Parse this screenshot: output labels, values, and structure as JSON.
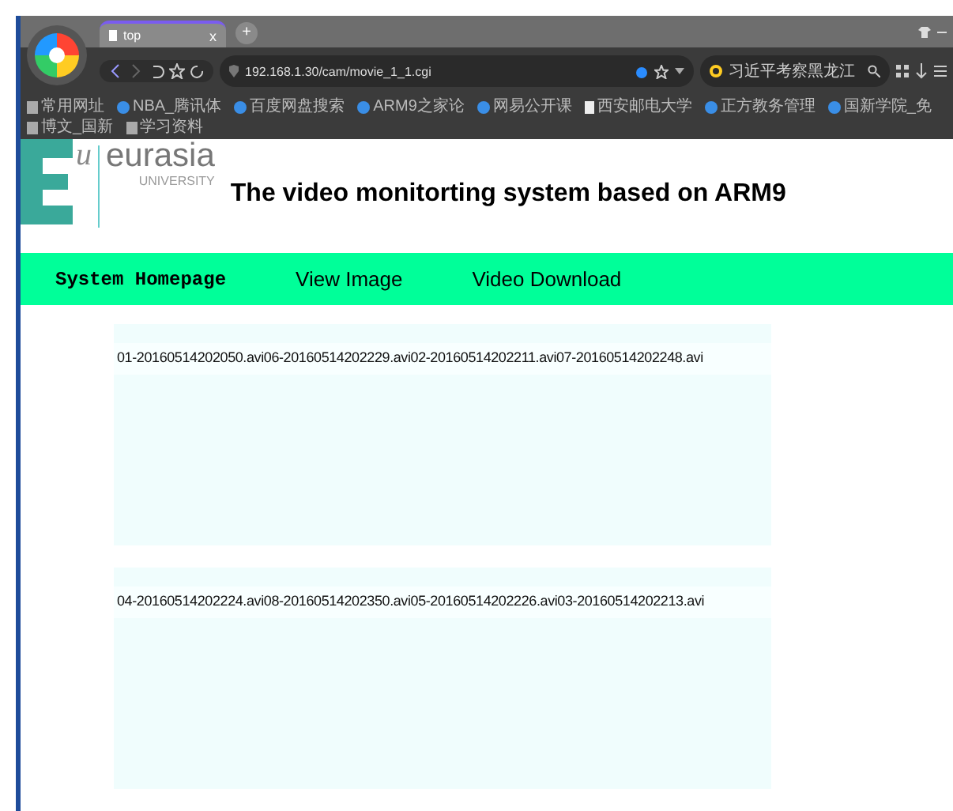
{
  "browser": {
    "tab": {
      "title": "top",
      "close": "x"
    },
    "new_tab": "+",
    "address": "192.168.1.30/cam/movie_1_1.cgi",
    "search": "习近平考察黑龙江",
    "bookmarks": [
      {
        "label": "常用网址",
        "kind": "folder"
      },
      {
        "label": "NBA_腾讯体",
        "kind": "site"
      },
      {
        "label": "百度网盘搜索",
        "kind": "site"
      },
      {
        "label": "ARM9之家论",
        "kind": "site"
      },
      {
        "label": "网易公开课",
        "kind": "site"
      },
      {
        "label": "西安邮电大学",
        "kind": "page"
      },
      {
        "label": "正方教务管理",
        "kind": "site"
      },
      {
        "label": "国新学院_免",
        "kind": "site"
      },
      {
        "label": "博文_国新",
        "kind": "folder"
      },
      {
        "label": "学习资料",
        "kind": "folder"
      }
    ]
  },
  "page": {
    "logo": {
      "mark": "u",
      "name": "eurasia",
      "subtitle": "UNIVERSITY"
    },
    "title": "The video monitorting system based on ARM9",
    "nav": [
      {
        "label": "System Homepage",
        "kind": "mono"
      },
      {
        "label": "View Image",
        "kind": "sans"
      },
      {
        "label": "Video Download",
        "kind": "sans"
      }
    ],
    "video_lists": [
      {
        "files": "01-20160514202050.avi06-20160514202229.avi02-20160514202211.avi07-20160514202248.avi"
      },
      {
        "files": "04-20160514202224.avi08-20160514202350.avi05-20160514202226.avi03-20160514202213.avi"
      }
    ]
  }
}
